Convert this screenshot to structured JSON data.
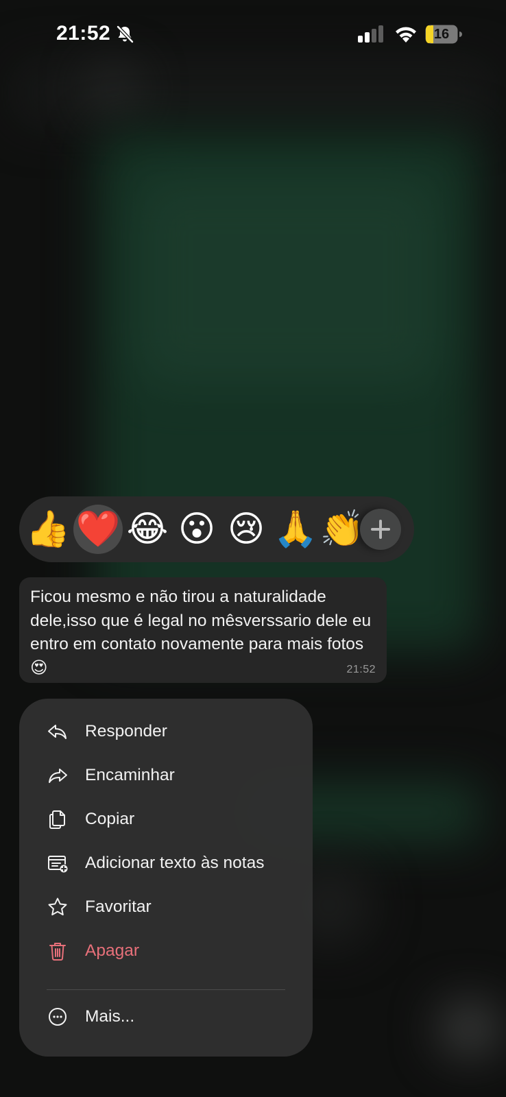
{
  "status_bar": {
    "time": "21:52",
    "battery_level": "16",
    "silent_icon": "bell-slash-icon",
    "signal_icon": "cellular-signal-icon",
    "wifi_icon": "wifi-icon",
    "battery_color": "#f5d426"
  },
  "reactions": {
    "items": [
      {
        "emoji": "👍",
        "name": "thumbs-up"
      },
      {
        "emoji": "❤️",
        "name": "red-heart"
      },
      {
        "emoji": "😂",
        "name": "tears-of-joy"
      },
      {
        "emoji": "😮",
        "name": "surprised"
      },
      {
        "emoji": "😢",
        "name": "crying"
      },
      {
        "emoji": "🙏",
        "name": "folded-hands"
      },
      {
        "emoji": "👏",
        "name": "clapping-hands"
      }
    ],
    "selected": "red-heart",
    "more_icon": "plus-icon"
  },
  "message": {
    "text": "Ficou mesmo e não tirou a naturalidade dele,isso que é legal no mêsverssario dele eu entro em contato novamente para mais fotos 😍",
    "time": "21:52"
  },
  "menu": {
    "reply": {
      "label": "Responder",
      "icon": "reply-icon"
    },
    "forward": {
      "label": "Encaminhar",
      "icon": "forward-icon"
    },
    "copy": {
      "label": "Copiar",
      "icon": "copy-icon"
    },
    "add_note": {
      "label": "Adicionar texto às notas",
      "icon": "add-note-icon"
    },
    "favorite": {
      "label": "Favoritar",
      "icon": "star-icon"
    },
    "delete": {
      "label": "Apagar",
      "icon": "trash-icon",
      "color": "#e8707a"
    },
    "more": {
      "label": "Mais...",
      "icon": "ellipsis-circle-icon"
    }
  }
}
